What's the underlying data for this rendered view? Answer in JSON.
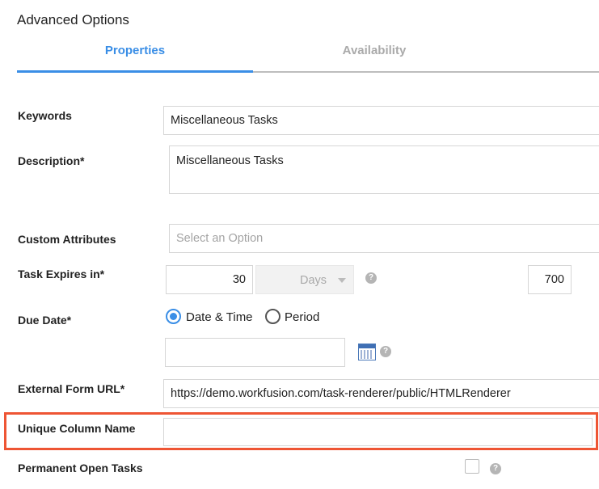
{
  "panel": {
    "title": "Advanced Options"
  },
  "tabs": [
    {
      "label": "Properties",
      "active": true
    },
    {
      "label": "Availability",
      "active": false
    }
  ],
  "form": {
    "keywords": {
      "label": "Keywords",
      "value": "Miscellaneous Tasks"
    },
    "description": {
      "label": "Description*",
      "value": "Miscellaneous Tasks"
    },
    "custom_attributes": {
      "label": "Custom Attributes",
      "placeholder": "Select an Option"
    },
    "task_expires": {
      "label": "Task Expires in*",
      "value": "30",
      "unit": "Days",
      "secondary_value": "700",
      "help": "?"
    },
    "due_date": {
      "label": "Due Date*",
      "options": [
        {
          "label": "Date & Time",
          "selected": true
        },
        {
          "label": "Period",
          "selected": false
        }
      ],
      "date_value": "",
      "help": "?"
    },
    "external_form_url": {
      "label": "External Form URL*",
      "value": "https://demo.workfusion.com/task-renderer/public/HTMLRenderer"
    },
    "unique_column_name": {
      "label": "Unique Column Name",
      "value": ""
    },
    "permanent_open_tasks": {
      "label": "Permanent Open Tasks",
      "checked": false,
      "help": "?"
    }
  },
  "colors": {
    "accent": "#3a8ee6",
    "highlight": "#ee5534"
  }
}
